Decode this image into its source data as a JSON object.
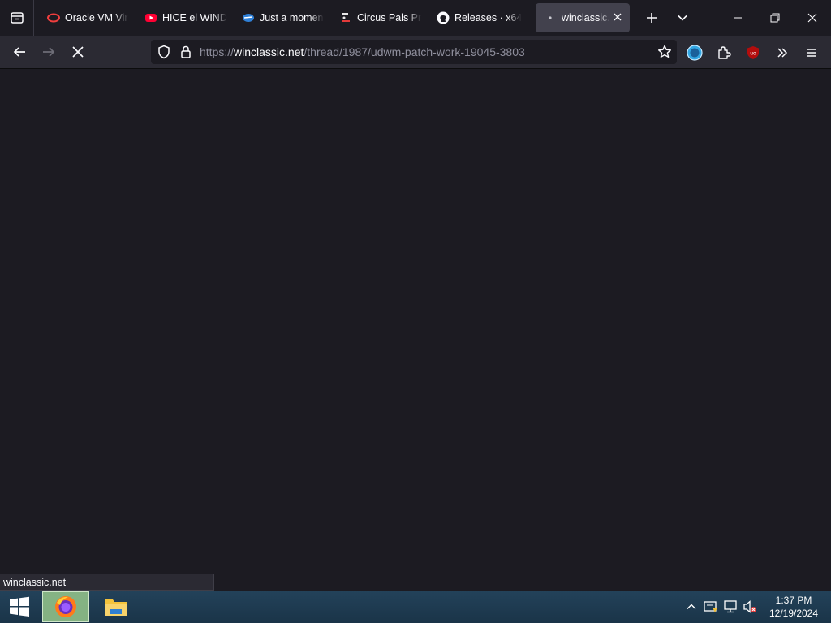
{
  "browser": {
    "tabs": [
      {
        "title": "Oracle VM Vir",
        "icon": "oracle-icon",
        "active": false
      },
      {
        "title": "HICE el WIND",
        "icon": "youtube-icon",
        "active": false
      },
      {
        "title": "Just a momen",
        "icon": "cloudflare-icon",
        "active": false
      },
      {
        "title": "Circus Pals Pr",
        "icon": "circus-icon",
        "active": false
      },
      {
        "title": "Releases · x64",
        "icon": "github-icon",
        "active": false
      },
      {
        "title": "winclassic.n",
        "icon": "loading-dot-icon",
        "active": true
      }
    ],
    "url": {
      "scheme": "https://",
      "host": "winclassic.net",
      "path": "/thread/1987/udwm-patch-work-19045-3803"
    },
    "status_text": "winclassic.net"
  },
  "taskbar": {
    "apps": [
      {
        "name": "Firefox",
        "icon": "firefox-icon",
        "active": true
      },
      {
        "name": "File Explorer",
        "icon": "folder-icon",
        "active": false
      }
    ],
    "clock": {
      "time": "1:37 PM",
      "date": "12/19/2024"
    }
  },
  "colors": {
    "background": "#1c1b22",
    "toolbar": "#2b2a33",
    "active_tab": "#42414d",
    "taskbar": "#1f3c52"
  }
}
